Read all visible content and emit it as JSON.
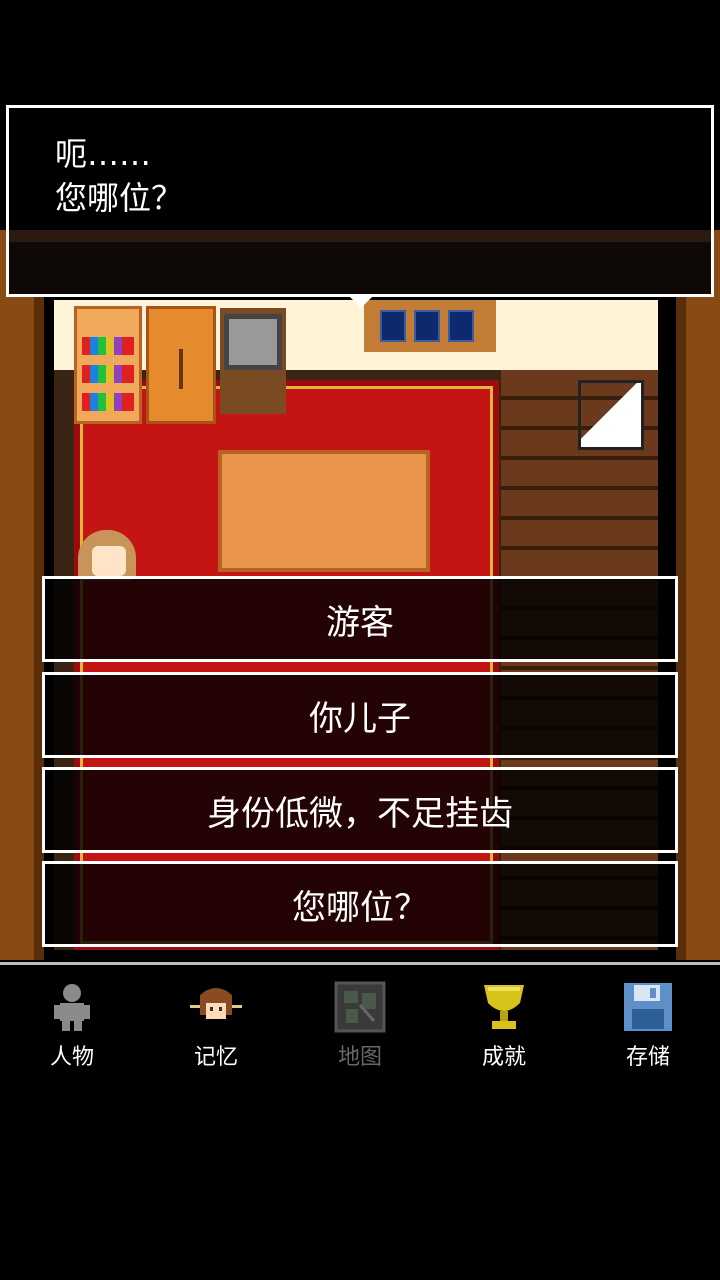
{
  "dialog": {
    "line1": "呃……",
    "line2": "您哪位？"
  },
  "choices": [
    {
      "label": "游客"
    },
    {
      "label": "你儿子"
    },
    {
      "label": "身份低微，不足挂齿"
    },
    {
      "label": "您哪位？"
    }
  ],
  "nav": {
    "items": [
      {
        "label": "人物",
        "icon": "person-icon"
      },
      {
        "label": "记忆",
        "icon": "memory-portrait-icon"
      },
      {
        "label": "地图",
        "icon": "map-icon",
        "disabled": true
      },
      {
        "label": "成就",
        "icon": "trophy-icon"
      },
      {
        "label": "存储",
        "icon": "save-disk-icon"
      }
    ]
  },
  "colors": {
    "carpet": "#c41414",
    "frame": "#8a4a14",
    "trophy": "#d8c21c",
    "disk": "#5f8fc8"
  }
}
